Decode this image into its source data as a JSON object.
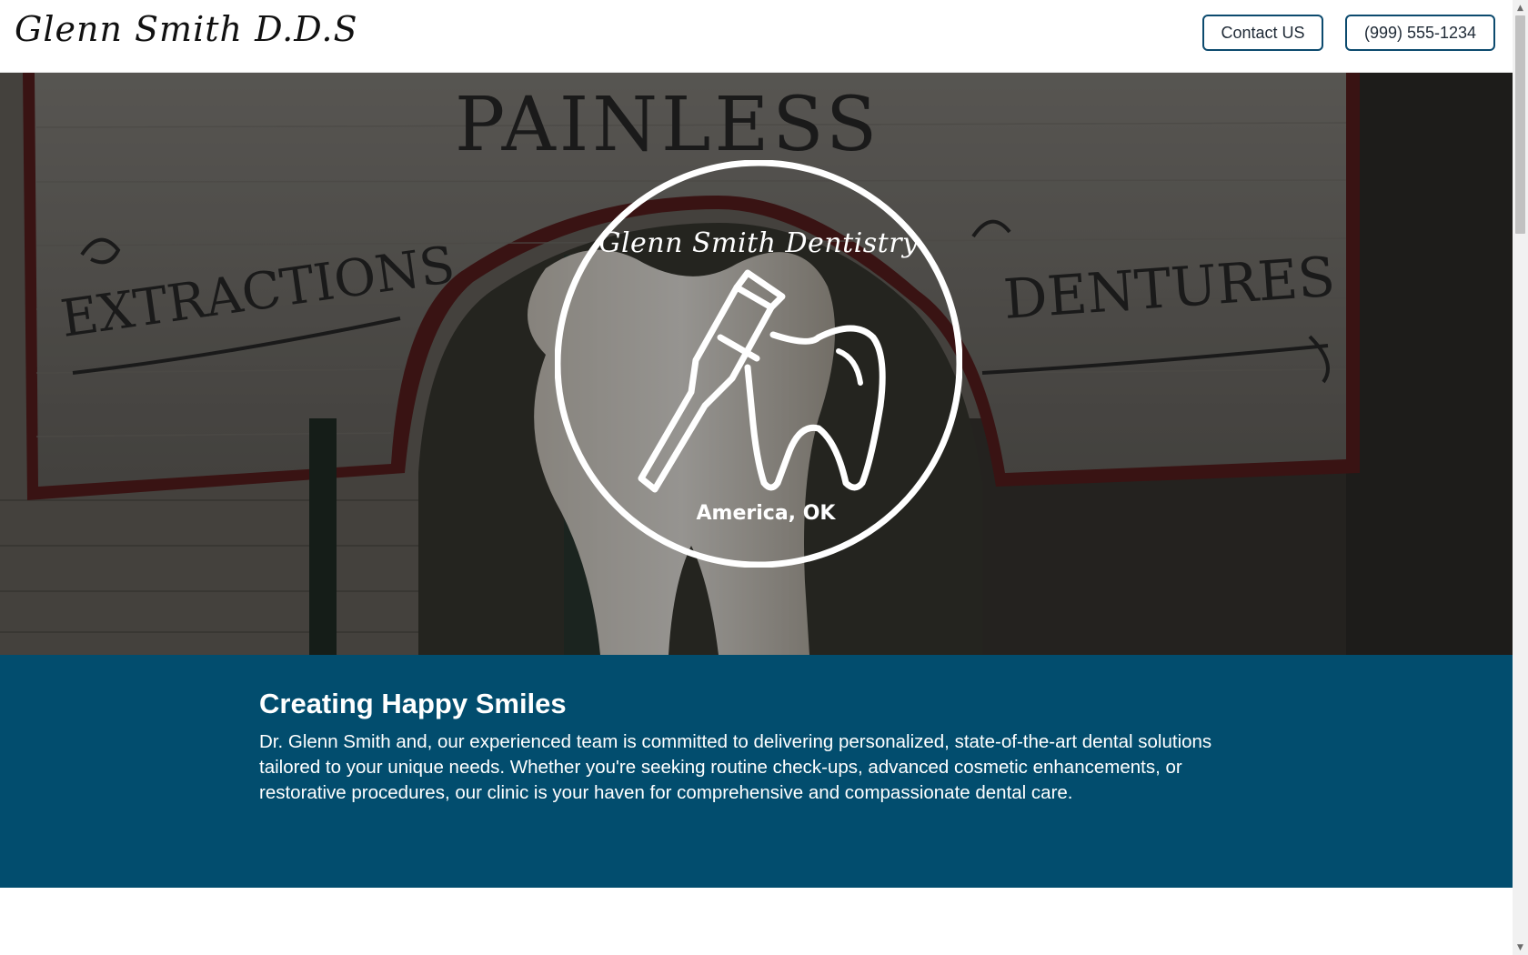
{
  "header": {
    "logo_text": "Glenn Smith D.D.S",
    "contact_label": "Contact US",
    "phone_label": "(999) 555-1234"
  },
  "hero": {
    "sign_top": "PAINLESS",
    "sign_left": "EXTRACTIONS",
    "sign_right": "DENTURES",
    "emblem_title": "Glenn Smith Dentistry",
    "emblem_location": "America, OK",
    "emblem_icon": "toothbrush-tooth-icon"
  },
  "about": {
    "heading": "Creating Happy Smiles",
    "body": "Dr. Glenn Smith and, our experienced team is committed to delivering personalized, state-of-the-art dental solutions tailored to your unique needs. Whether you're seeking routine check-ups, advanced cosmetic enhancements, or restorative procedures, our clinic is your haven for comprehensive and compassionate dental care."
  },
  "colors": {
    "brand_blue": "#024d6e",
    "button_border": "#0c4a6e",
    "hero_overlay": "#1a1a1a"
  }
}
